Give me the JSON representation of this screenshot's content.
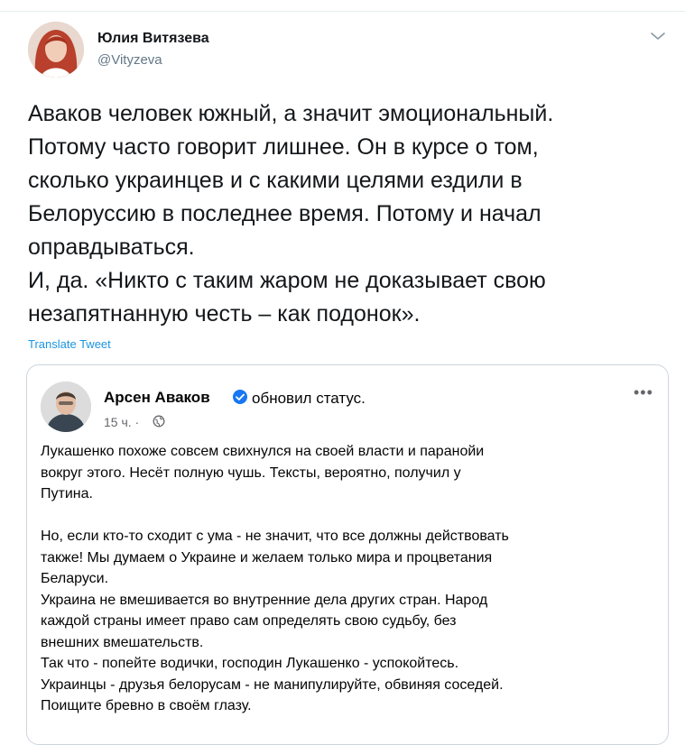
{
  "tweet": {
    "author_name": "Юлия Витязева",
    "author_handle": "@Vityzeva",
    "text": "Аваков человек южный, а значит эмоциональный.\nПотому часто говорит лишнее. Он в курсе о том,\nсколько украинцев и с какими целями ездили в\nБелоруссию в последнее время. Потому и начал\nоправдываться.\nИ, да. «Никто с таким жаром не доказывает свою\nнезапятнанную честь – как подонок».",
    "translate_label": "Translate Tweet"
  },
  "quoted_post": {
    "author_name": "Арсен Аваков",
    "action": "обновил статус.",
    "time": "15 ч. ·",
    "more_label": "•••",
    "body": "Лукашенко похоже совсем свихнулся на своей власти и паранойи\nвокруг этого. Несёт полную чушь. Тексты, вероятно, получил у\nПутина.\n\nНо, если кто-то сходит с ума - не значит, что все должны действовать\nтакже!  Мы думаем о Украине  и желаем только  мира и процветания\nБеларуси.\nУкраина не вмешивается во внутренние дела других стран. Народ\nкаждой страны имеет право сам определять свою судьбу, без\nвнешних вмешательств.\nТак что - попейте водички, господин Лукашенко - успокойтесь.\nУкраинцы - друзья белорусам -  не манипулируйте, обвиняя соседей.\nПоищите бревно в своём глазу."
  },
  "colors": {
    "link": "#1b95e0",
    "verified": "#1877f2",
    "secondary_text": "#657786"
  }
}
